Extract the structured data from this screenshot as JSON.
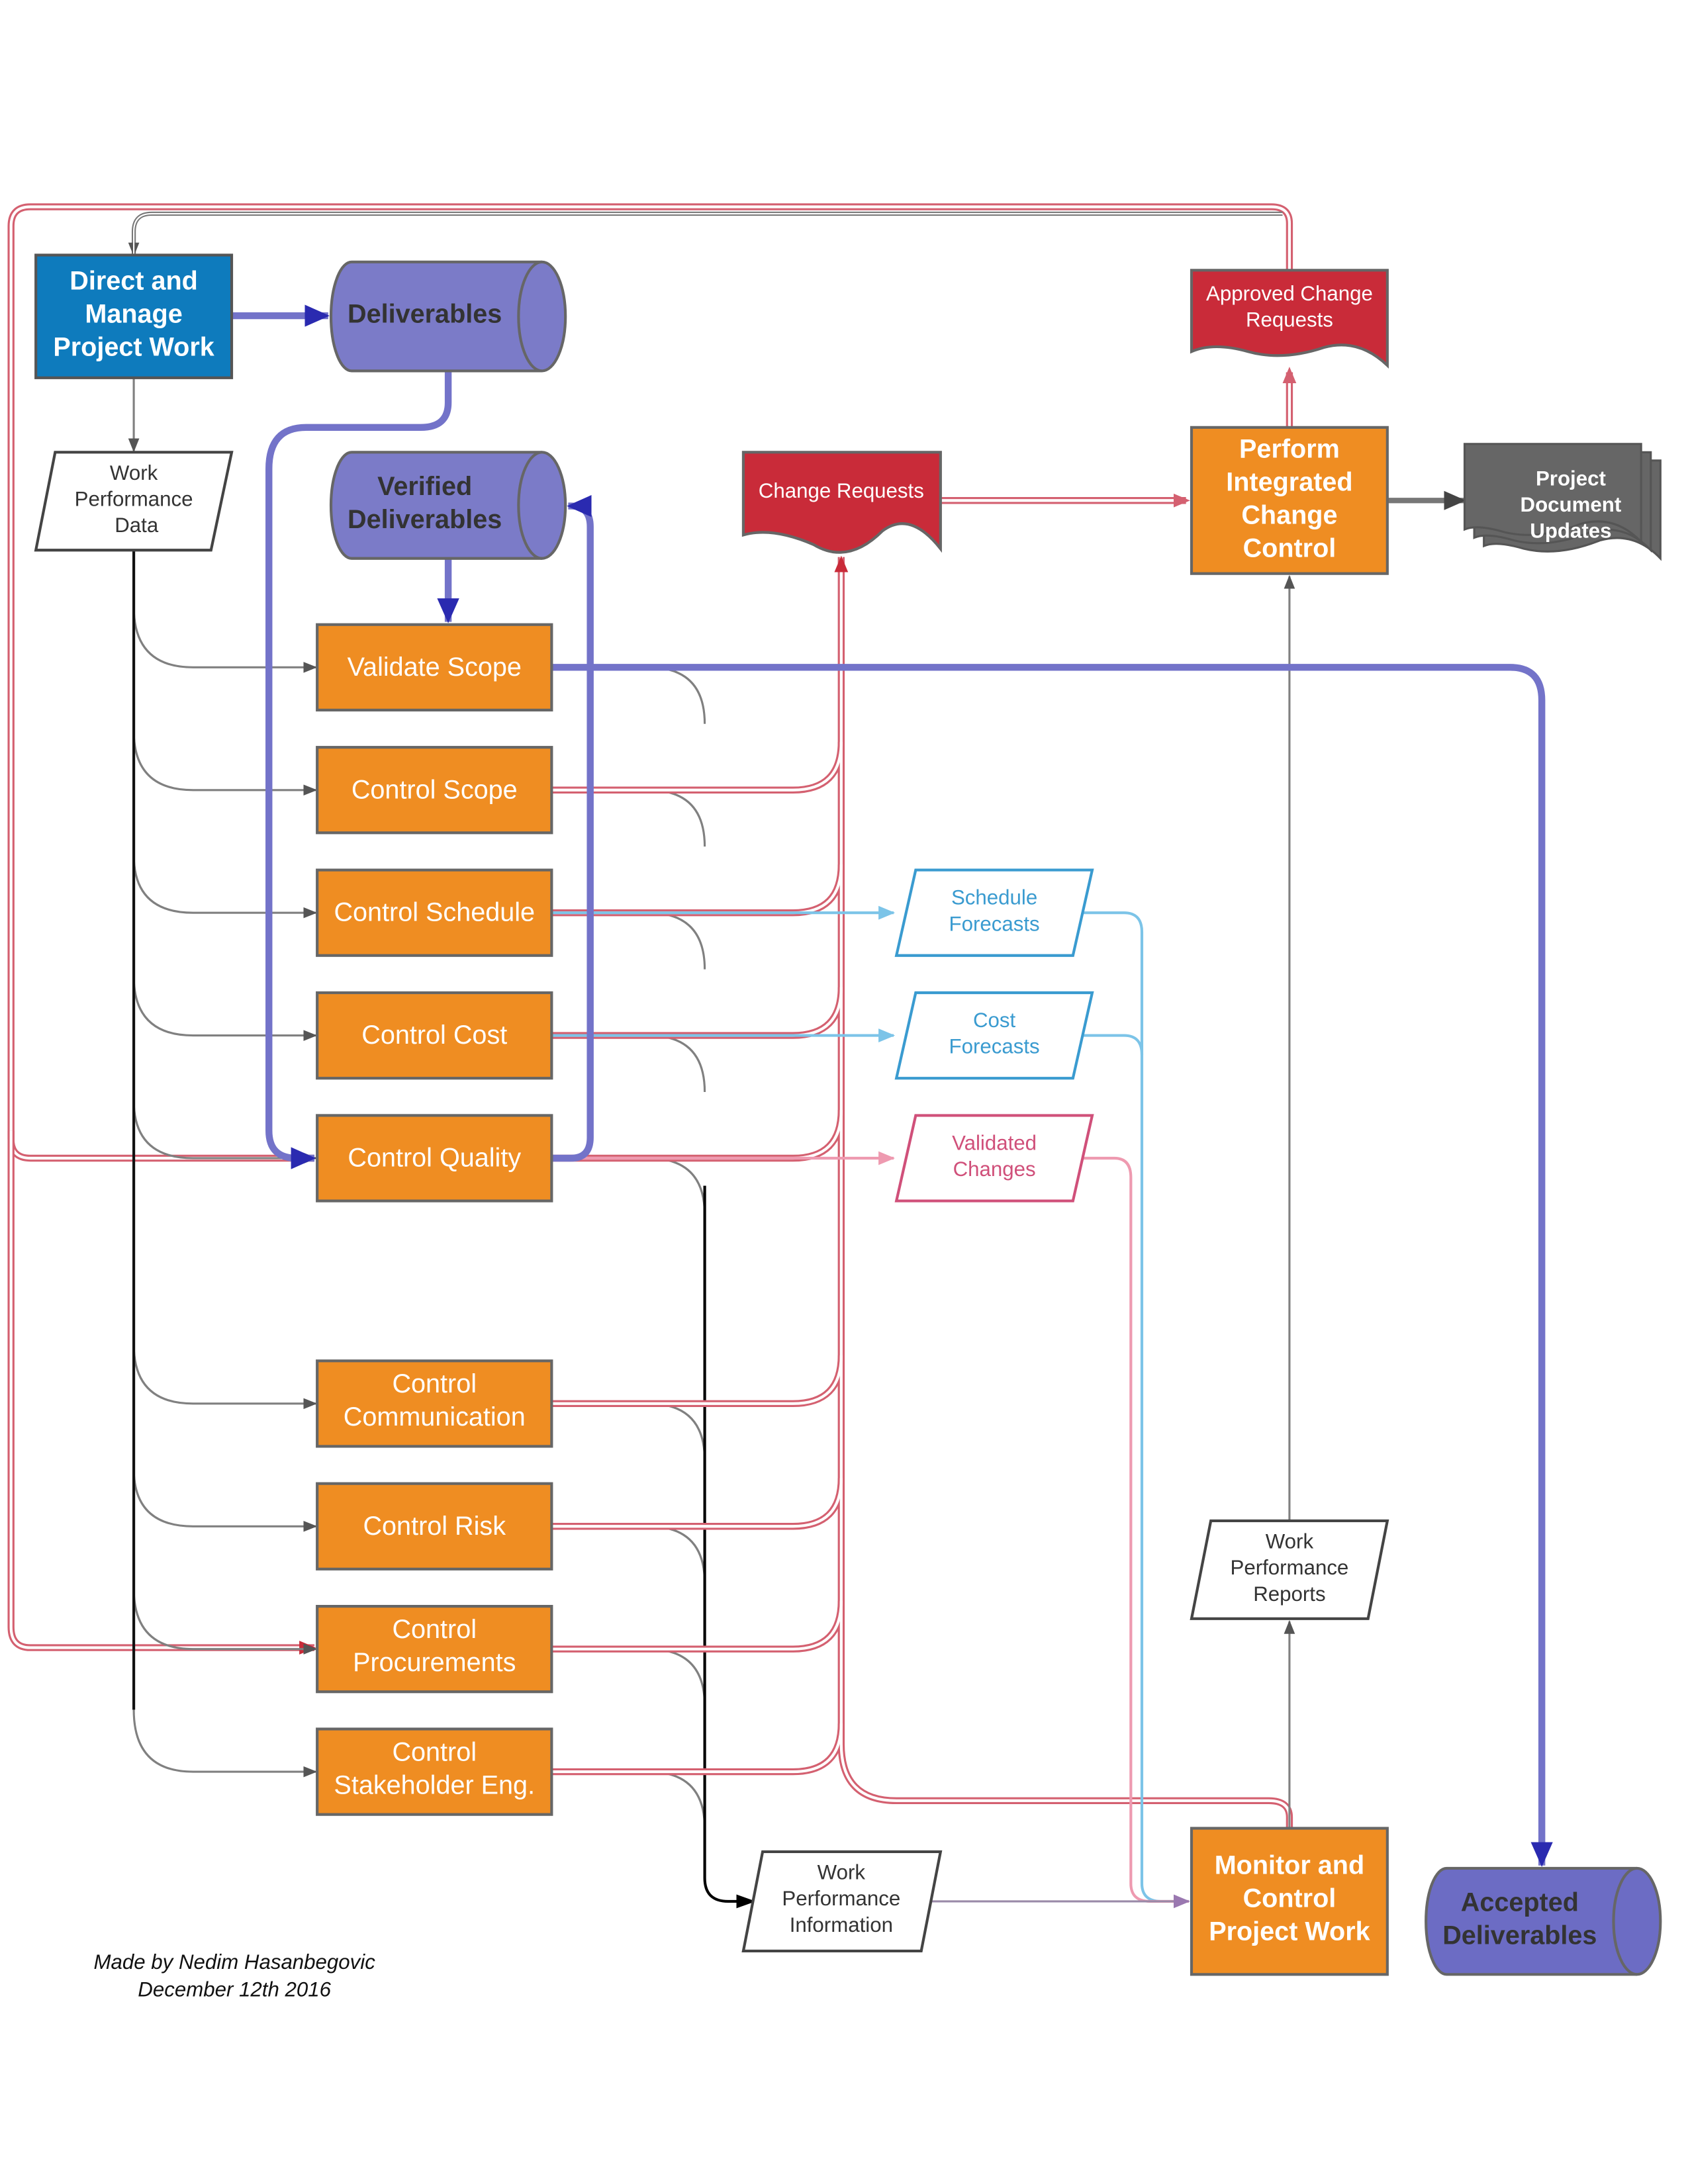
{
  "colors": {
    "process_blue": "#0e7bbd",
    "process_orange": "#ef8d22",
    "data_store_purple": "#7b7bc8",
    "change_red": "#c92b39",
    "document_gray": "#666666",
    "forecast_blue": "#3a9bd0",
    "validated_pink": "#d0507a"
  },
  "nodes": {
    "direct_manage": {
      "lines": [
        "Direct and",
        "Manage",
        "Project Work"
      ]
    },
    "deliverables": {
      "lines": [
        "Deliverables"
      ]
    },
    "work_performance_data": {
      "lines": [
        "Work",
        "Performance",
        "Data"
      ]
    },
    "verified_deliverables": {
      "lines": [
        "Verified",
        "Deliverables"
      ]
    },
    "change_requests": {
      "lines": [
        "Change Requests"
      ]
    },
    "perform_icc": {
      "lines": [
        "Perform",
        "Integrated",
        "Change",
        "Control"
      ]
    },
    "approved_change_requests": {
      "lines": [
        "Approved Change",
        "Requests"
      ]
    },
    "project_document_updates": {
      "lines": [
        "Project",
        "Document",
        "Updates"
      ]
    },
    "validate_scope": {
      "lines": [
        "Validate Scope"
      ]
    },
    "control_scope": {
      "lines": [
        "Control Scope"
      ]
    },
    "control_schedule": {
      "lines": [
        "Control Schedule"
      ]
    },
    "control_cost": {
      "lines": [
        "Control Cost"
      ]
    },
    "control_quality": {
      "lines": [
        "Control Quality"
      ]
    },
    "control_communication": {
      "lines": [
        "Control",
        "Communication"
      ]
    },
    "control_risk": {
      "lines": [
        "Control Risk"
      ]
    },
    "control_procurements": {
      "lines": [
        "Control",
        "Procurements"
      ]
    },
    "control_stakeholder": {
      "lines": [
        "Control",
        "Stakeholder Eng."
      ]
    },
    "schedule_forecasts": {
      "lines": [
        "Schedule",
        "Forecasts"
      ]
    },
    "cost_forecasts": {
      "lines": [
        "Cost",
        "Forecasts"
      ]
    },
    "validated_changes": {
      "lines": [
        "Validated",
        "Changes"
      ]
    },
    "work_performance_reports": {
      "lines": [
        "Work",
        "Performance",
        "Reports"
      ]
    },
    "work_performance_information": {
      "lines": [
        "Work",
        "Performance",
        "Information"
      ]
    },
    "monitor_control": {
      "lines": [
        "Monitor and",
        "Control",
        "Project Work"
      ]
    },
    "accepted_deliverables": {
      "lines": [
        "Accepted",
        "Deliverables"
      ]
    }
  },
  "credit": {
    "line1": "Made by Nedim Hasanbegovic",
    "line2": "December 12th 2016"
  }
}
